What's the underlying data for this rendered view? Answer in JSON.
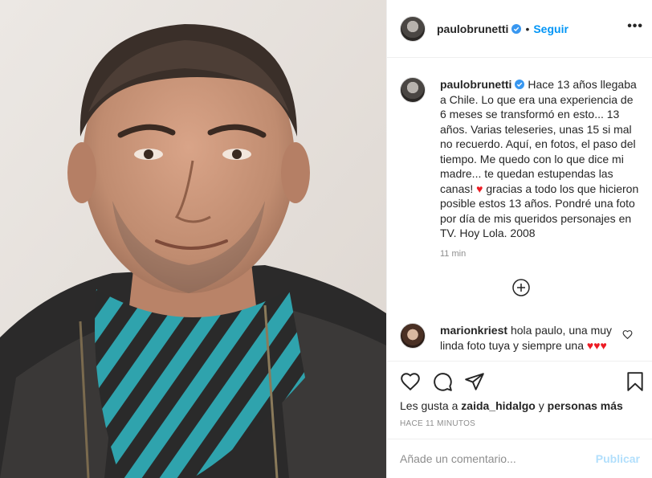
{
  "post": {
    "photo_alt": "photo",
    "author": "paulobrunetti",
    "follow_label": "Seguir",
    "separator": "•",
    "more_icon": "more-horizontal-icon",
    "more_label": "•••"
  },
  "caption": {
    "username": "paulobrunetti",
    "text_before_heart": "Hace 13 años llegaba a Chile. Lo que era una experiencia de 6 meses se transformó en esto... 13 años. Varias teleseries, unas 15 si mal no recuerdo. Aquí, en fotos, el paso del tiempo. Me quedo con lo que dice mi madre... te quedan estupendas las canas!",
    "heart": "♥",
    "text_after_heart": "gracias a todo los que hicieron posible estos 13 años. Pondré una foto por día de mis queridos personajes en TV. Hoy Lola. 2008",
    "time": "11 min"
  },
  "load_more_icon": "plus-circle-icon",
  "comment": {
    "username": "marionkriest",
    "text": "hola paulo, una muy linda foto tuya y siempre una",
    "hearts": "♥♥♥"
  },
  "actions": {
    "like_icon": "heart-icon",
    "comment_icon": "comment-icon",
    "share_icon": "share-icon",
    "save_icon": "bookmark-icon"
  },
  "likes": {
    "prefix": "Les gusta a",
    "user": "zaida_hidalgo",
    "joiner": "y",
    "others": "personas más"
  },
  "timestamp": "HACE 11 MINUTOS",
  "composer": {
    "placeholder": "Añade un comentario...",
    "publish_label": "Publicar"
  },
  "colors": {
    "accent": "#0095f6",
    "publish_disabled": "#b2dffc",
    "heart": "#ed1c24",
    "muted": "#8e8e8e"
  }
}
